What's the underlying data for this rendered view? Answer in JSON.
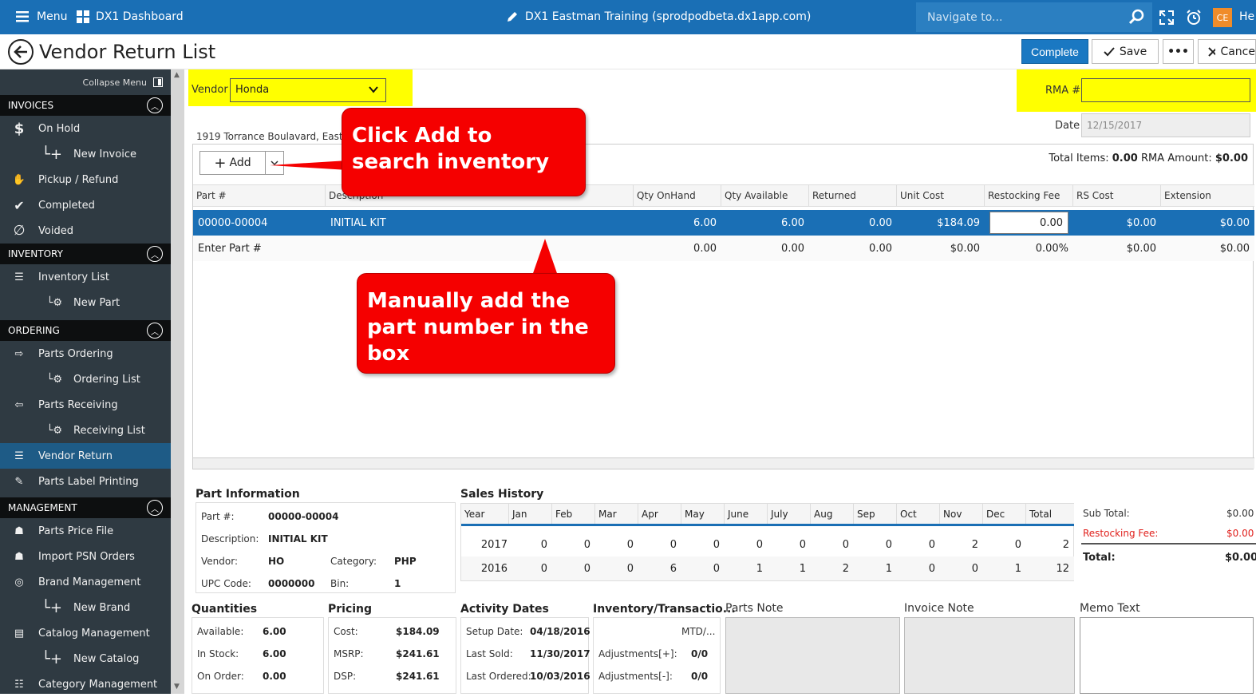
{
  "topbar": {
    "menu_label": "Menu",
    "dashboard_label": "DX1 Dashboard",
    "title": "DX1 Eastman Training (sprodpodbeta.dx1app.com)",
    "nav_placeholder": "Navigate to...",
    "avatar": "CE",
    "user_name": "He"
  },
  "page": {
    "title": "Vendor Return List",
    "complete_label": "Complete",
    "save_label": "Save",
    "more_label": "•••",
    "cancel_label": "Cance"
  },
  "sidebar": {
    "collapse_label": "Collapse Menu",
    "sections": {
      "invoices": "INVOICES",
      "inventory": "INVENTORY",
      "ordering": "ORDERING",
      "management": "MANAGEMENT"
    },
    "items": {
      "on_hold": "On Hold",
      "new_invoice": "New Invoice",
      "pickup_refund": "Pickup / Refund",
      "completed": "Completed",
      "voided": "Voided",
      "inventory_list": "Inventory List",
      "new_part": "New Part",
      "parts_ordering": "Parts Ordering",
      "ordering_list": "Ordering List",
      "parts_receiving": "Parts Receiving",
      "receiving_list": "Receiving List",
      "vendor_return": "Vendor Return",
      "parts_label_printing": "Parts Label Printing",
      "parts_price_file": "Parts Price File",
      "import_psn_orders": "Import PSN Orders",
      "brand_management": "Brand Management",
      "new_brand": "New Brand",
      "catalog_management": "Catalog Management",
      "new_catalog": "New Catalog",
      "category_management": "Category Management"
    }
  },
  "form": {
    "vendor_label": "Vendor",
    "vendor_value": "Honda",
    "address": "1919 Torrance Boulavard, Eastga",
    "rma_label": "RMA #",
    "rma_value": "",
    "date_label": "Date",
    "date_value": "12/15/2017"
  },
  "grid": {
    "add_label": "Add",
    "total_items_label": "Total Items:",
    "total_items_value": "0.00",
    "rma_amount_label": "RMA Amount:",
    "rma_amount_value": "$0.00",
    "columns": [
      "Part #",
      "Description",
      "Qty OnHand",
      "Qty Available",
      "Returned",
      "Unit Cost",
      "Restocking Fee",
      "RS Cost",
      "Extension"
    ],
    "rows": [
      [
        "00000-00004",
        "INITIAL KIT",
        "6.00",
        "6.00",
        "0.00",
        "$184.09",
        "0.00",
        "$0.00",
        "$0.00"
      ],
      [
        "Enter Part #",
        "",
        "0.00",
        "0.00",
        "0.00",
        "$0.00",
        "0.00%",
        "$0.00",
        "$0.00"
      ]
    ]
  },
  "callouts": {
    "add": "Click Add to search inventory",
    "manual": "Manually add the part number in the box"
  },
  "part_info": {
    "title": "Part Information",
    "part_label": "Part #:",
    "part_value": "00000-00004",
    "desc_label": "Description:",
    "desc_value": "INITIAL KIT",
    "vendor_label": "Vendor:",
    "vendor_value": "HO",
    "category_label": "Category:",
    "category_value": "PHP",
    "upc_label": "UPC Code:",
    "upc_value": "0000000",
    "bin_label": "Bin:",
    "bin_value": "1"
  },
  "sales_history": {
    "title": "Sales History",
    "columns": [
      "Year",
      "Jan",
      "Feb",
      "Mar",
      "Apr",
      "May",
      "June",
      "July",
      "Aug",
      "Sep",
      "Oct",
      "Nov",
      "Dec",
      "Total"
    ],
    "rows": [
      [
        "2017",
        "0",
        "0",
        "0",
        "0",
        "0",
        "0",
        "0",
        "0",
        "0",
        "0",
        "2",
        "0",
        "2"
      ],
      [
        "2016",
        "0",
        "0",
        "0",
        "6",
        "0",
        "1",
        "1",
        "2",
        "1",
        "0",
        "0",
        "1",
        "12"
      ]
    ]
  },
  "summary": {
    "subtotal_label": "Sub Total:",
    "subtotal_value": "$0.00",
    "restocking_label": "Restocking Fee:",
    "restocking_value": "$0.00",
    "total_label": "Total:",
    "total_value": "$0.00",
    "accent_red": "#e0201c"
  },
  "quantities": {
    "title": "Quantities",
    "available_label": "Available:",
    "available_value": "6.00",
    "instock_label": "In Stock:",
    "instock_value": "6.00",
    "onorder_label": "On Order:",
    "onorder_value": "0.00"
  },
  "pricing": {
    "title": "Pricing",
    "cost_label": "Cost:",
    "cost_value": "$184.09",
    "msrp_label": "MSRP:",
    "msrp_value": "$241.61",
    "dsp_label": "DSP:",
    "dsp_value": "$241.61"
  },
  "activity": {
    "title": "Activity Dates",
    "setup_label": "Setup Date:",
    "setup_value": "04/18/2016",
    "lastsold_label": "Last Sold:",
    "lastsold_value": "11/30/2017",
    "lastordered_label": "Last Ordered:",
    "lastordered_value": "10/03/2016"
  },
  "inventory_tx": {
    "title": "Inventory/Transactio...",
    "mtd_label": "MTD/...",
    "adj_plus_label": "Adjustments[+]:",
    "adj_plus_value": "0/0",
    "adj_minus_label": "Adjustments[-]:",
    "adj_minus_value": "0/0"
  },
  "notes": {
    "parts_note": "Parts Note",
    "invoice_note": "Invoice Note",
    "memo_text": "Memo Text"
  }
}
